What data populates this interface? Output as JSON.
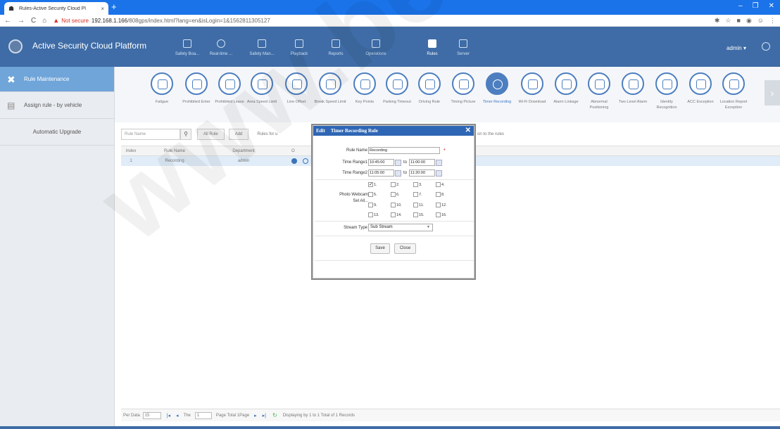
{
  "browser": {
    "tab_title": "Rules-Active Security Cloud Pl",
    "tab_close": "×",
    "new_tab": "+",
    "not_secure": "Not secure",
    "url_host": "192.168.1.166",
    "url_path": "/808gps/index.html?lang=en&isLogin=1&1562811305127",
    "window_controls": [
      "–",
      "❐",
      "✕"
    ]
  },
  "app": {
    "title": "Active Security Cloud Platform",
    "menu": [
      {
        "label": "Safety Boa...",
        "icon": "shield-icon"
      },
      {
        "label": "Real-time ...",
        "icon": "location-icon"
      },
      {
        "label": "Safety Man...",
        "icon": "shield-check-icon"
      },
      {
        "label": "Playback",
        "icon": "playback-icon"
      },
      {
        "label": "Reports",
        "icon": "bar-chart-icon"
      },
      {
        "label": "Operations",
        "icon": "operations-icon"
      },
      {
        "label": "Rules",
        "icon": "rules-icon"
      },
      {
        "label": "Server",
        "icon": "server-icon"
      }
    ],
    "user": "admin ▾"
  },
  "sidebar": {
    "items": [
      {
        "label": "Rule Maintenance",
        "icon": "tools-icon"
      },
      {
        "label": "Assign rule - by vehicle",
        "icon": "vehicle-list-icon"
      },
      {
        "label": "Automatic Upgrade"
      }
    ]
  },
  "rule_icons": [
    {
      "label": "Fatigue"
    },
    {
      "label": "Prohibited Enter"
    },
    {
      "label": "Prohibited Leave"
    },
    {
      "label": "Area Speed Limit"
    },
    {
      "label": "Line Offset"
    },
    {
      "label": "Break Speed Limit"
    },
    {
      "label": "Key Points"
    },
    {
      "label": "Parking Timeout"
    },
    {
      "label": "Driving Rule"
    },
    {
      "label": "Timing Picture"
    },
    {
      "label": "Timer Recording"
    },
    {
      "label": "Wi-Fi Download"
    },
    {
      "label": "Alarm Linkage"
    },
    {
      "label": "Abnormal Positioning"
    },
    {
      "label": "Two Level Alarm"
    },
    {
      "label": "Identity Recognition"
    },
    {
      "label": "ACC Exception"
    },
    {
      "label": "Location Report Exception"
    }
  ],
  "toolbar": {
    "search_placeholder": "Rule Name",
    "all_rule": "All Rule",
    "add": "Add",
    "rules_for": "Rules for u",
    "rules_tail": "on to the rules"
  },
  "table": {
    "headers": {
      "index": "Index",
      "name": "Rule Name",
      "dept": "Department",
      "op": "O"
    },
    "rows": [
      {
        "index": "1",
        "name": "Recording",
        "dept": "admin"
      }
    ]
  },
  "pager": {
    "per_data": "Per Data",
    "per_value": "15",
    "the": "The",
    "page_value": "1",
    "page_total": "Page  Total 1Page",
    "displaying": "Displaying by 1 to 1 Total of 1 Records"
  },
  "modal": {
    "edit": "Edit",
    "title": "Timer Recording Rule",
    "close_icon": "✕",
    "rule_name_label": "Rule Name",
    "rule_name_value": "Recording",
    "required": "*",
    "time_range1_label": "Time Range1",
    "time_range1_from": "10:45:00",
    "time_range1_to": "11:00:00",
    "time_range2_label": "Time Range2",
    "time_range2_from": "11:05:00",
    "time_range2_to": "11:20:00",
    "to": "to",
    "photo_webcam_label": "Photo Webcam",
    "sel_all_label": "Sel All...",
    "webcams": [
      {
        "label": "1.",
        "checked": true
      },
      {
        "label": "2.",
        "checked": false
      },
      {
        "label": "3.",
        "checked": false
      },
      {
        "label": "4.",
        "checked": false
      },
      {
        "label": "5.",
        "checked": false
      },
      {
        "label": "6.",
        "checked": false
      },
      {
        "label": "7.",
        "checked": false
      },
      {
        "label": "8.",
        "checked": false
      },
      {
        "label": "9.",
        "checked": false
      },
      {
        "label": "10.",
        "checked": false
      },
      {
        "label": "11.",
        "checked": false
      },
      {
        "label": "12.",
        "checked": false
      },
      {
        "label": "13.",
        "checked": false
      },
      {
        "label": "14.",
        "checked": false
      },
      {
        "label": "15.",
        "checked": false
      },
      {
        "label": "16.",
        "checked": false
      }
    ],
    "stream_type_label": "Stream Type",
    "stream_type_value": "Sub Stream",
    "save": "Save",
    "close": "Close"
  },
  "watermark": "www.bezpeka-S",
  "colors": {
    "tabbar": "#1a73e8",
    "app_header": "#3f6ca6",
    "accent": "#4d7ec0",
    "sidebar_active": "#6fa5d9",
    "modal_header": "#2e66b5"
  }
}
